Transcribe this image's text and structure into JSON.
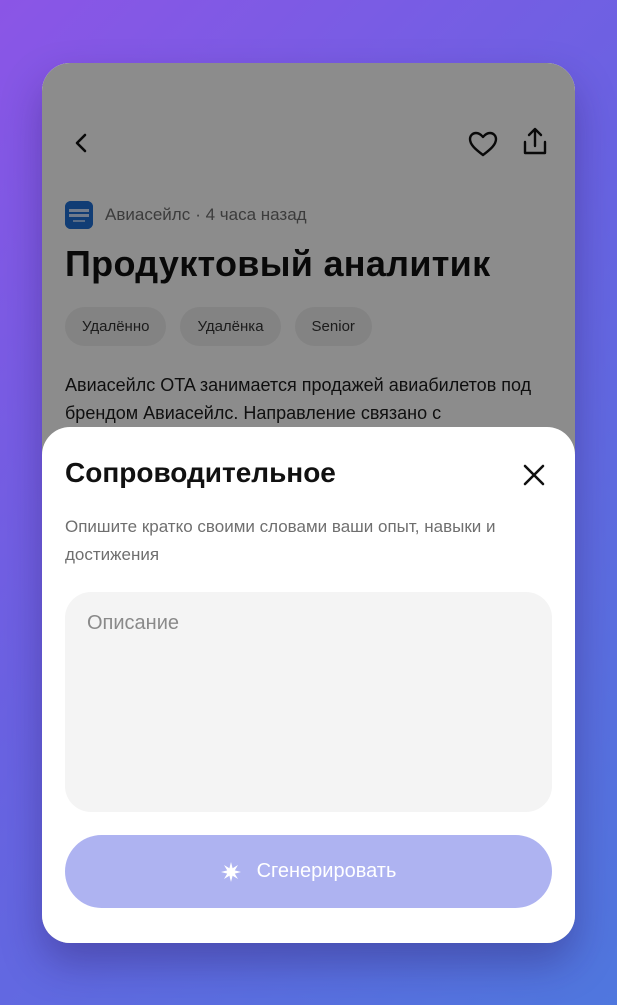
{
  "job": {
    "company": "Авиасейлс",
    "posted": "· 4 часа назад",
    "title": "Продуктовый аналитик",
    "tags": [
      "Удалённо",
      "Удалёнка",
      "Senior"
    ],
    "description": "Авиасейлс OTA занимается продажей авиабилетов под брендом Авиасейлс. Направление связано с"
  },
  "topbar": {
    "back_icon": "chevron-left-icon",
    "like_icon": "heart-icon",
    "share_icon": "share-icon"
  },
  "sheet": {
    "title": "Сопроводительное",
    "hint": "Опишите кратко своими словами ваши опыт, навыки и достижения",
    "input_value": "",
    "input_placeholder": "Описание",
    "generate_label": "Сгенерировать",
    "generate_icon": "sparkle-icon",
    "close_icon": "close-icon"
  },
  "colors": {
    "accent_disabled": "#aeb3f1",
    "logo_blue": "#1f6fd6",
    "background_gradient_start": "#8b55e6",
    "background_gradient_end": "#4f77de"
  }
}
